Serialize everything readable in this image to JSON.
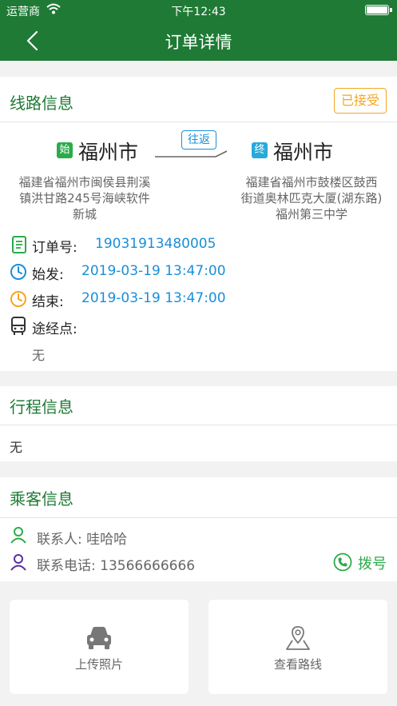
{
  "status_bar": {
    "carrier": "运营商",
    "time": "下午12:43",
    "wifi_icon": "wifi-icon",
    "battery_icon": "battery-icon"
  },
  "nav": {
    "title": "订单详情",
    "back_icon": "chevron-left-icon"
  },
  "route": {
    "section_title": "线路信息",
    "status_badge": "已接受",
    "trip_type": "往返",
    "start": {
      "tag": "始",
      "city": "福州市",
      "address_lines": [
        "福建省福州市闽侯县荆溪",
        "镇洪甘路245号海峡软件",
        "新城"
      ]
    },
    "end": {
      "tag": "终",
      "city": "福州市",
      "address_lines": [
        "福建省福州市鼓楼区鼓西",
        "街道奥林匹克大厦(湖东路)",
        "福州第三中学"
      ]
    },
    "order_no_label": "订单号:",
    "order_no": "19031913480005",
    "start_time_label": "始发:",
    "start_time": "2019-03-19 13:47:00",
    "end_time_label": "结束:",
    "end_time": "2019-03-19 13:47:00",
    "waypoints_label": "途经点:",
    "waypoints_value": "无"
  },
  "itinerary": {
    "section_title": "行程信息",
    "content": "无"
  },
  "passenger": {
    "section_title": "乘客信息",
    "contact": "联系人: 哇哈哈",
    "phone": "联系电话: 13566666666",
    "call_label": "拨号"
  },
  "actions": {
    "upload_photo": "上传照片",
    "view_route": "查看路线"
  },
  "colors": {
    "header_green": "#1f7a35",
    "accent_blue": "#1a8ed8",
    "badge_orange": "#f5a623",
    "start_tag_green": "#2bab4a",
    "end_tag_blue": "#29a9dc",
    "call_green": "#2bab4a"
  }
}
